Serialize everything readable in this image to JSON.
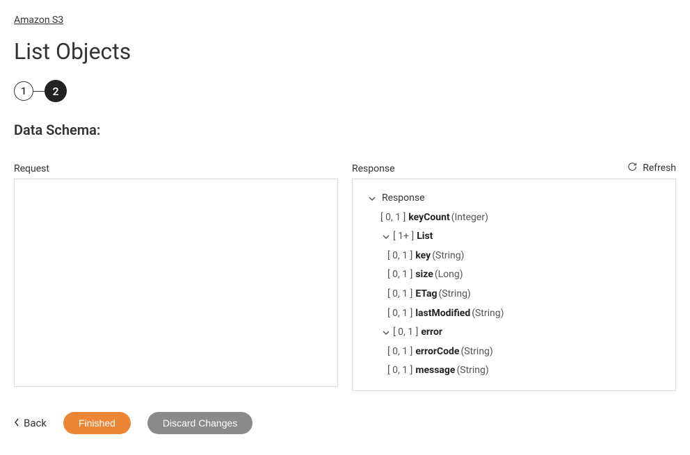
{
  "breadcrumb": "Amazon S3",
  "page_title": "List Objects",
  "steps": {
    "inactive": "1",
    "active": "2"
  },
  "section_title": "Data Schema:",
  "request_label": "Request",
  "response_label": "Response",
  "refresh_label": "Refresh",
  "tree": {
    "root": "Response",
    "keyCount": {
      "card": "[ 0, 1 ]",
      "name": "keyCount",
      "type": "(Integer)"
    },
    "list": {
      "card": "[ 1+ ]",
      "name": "List"
    },
    "key": {
      "card": "[ 0, 1 ]",
      "name": "key",
      "type": "(String)"
    },
    "size": {
      "card": "[ 0, 1 ]",
      "name": "size",
      "type": "(Long)"
    },
    "etag": {
      "card": "[ 0, 1 ]",
      "name": "ETag",
      "type": "(String)"
    },
    "lastModified": {
      "card": "[ 0, 1 ]",
      "name": "lastModified",
      "type": "(String)"
    },
    "error": {
      "card": "[ 0, 1 ]",
      "name": "error"
    },
    "errorCode": {
      "card": "[ 0, 1 ]",
      "name": "errorCode",
      "type": "(String)"
    },
    "message": {
      "card": "[ 0, 1 ]",
      "name": "message",
      "type": "(String)"
    }
  },
  "buttons": {
    "back": "Back",
    "finished": "Finished",
    "discard": "Discard Changes"
  }
}
